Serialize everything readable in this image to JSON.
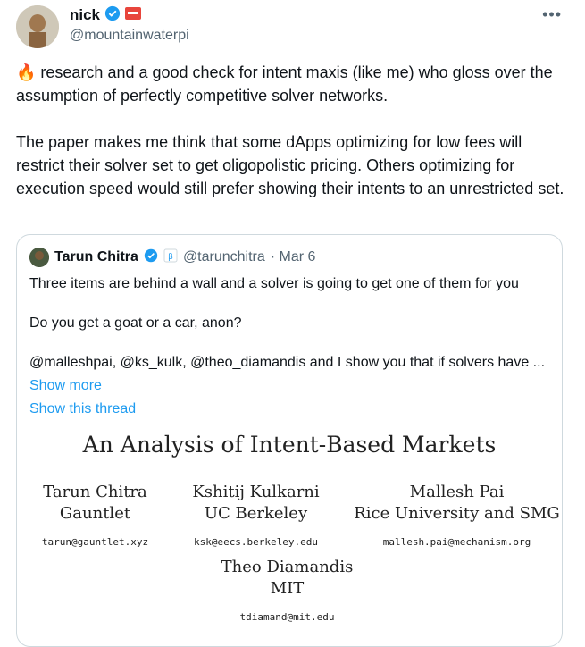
{
  "tweet": {
    "name": "nick",
    "handle": "@mountainwaterpi",
    "paragraphs": [
      "🔥 research and a good check for intent maxis (like me) who gloss over the assumption of perfectly competitive solver networks.",
      "The paper makes me think that some dApps optimizing for low fees will restrict their solver set to get oligopolistic pricing. Others optimizing for execution speed would still prefer showing their intents to an unrestricted set."
    ]
  },
  "quote": {
    "name": "Tarun Chitra",
    "handle": "@tarunchitra",
    "date": "· Mar 6",
    "lines": [
      "Three items are behind a wall and a solver is going to get one of them for you",
      "Do you get a goat or a car, anon?",
      "@malleshpai, @ks_kulk, @theo_diamandis and I show you that if solvers have ..."
    ],
    "show_more": "Show more",
    "show_thread": "Show this thread"
  },
  "paper": {
    "title": "An Analysis of Intent-Based Markets",
    "authors": [
      {
        "name": "Tarun Chitra",
        "affiliation": "Gauntlet",
        "email": "tarun@gauntlet.xyz"
      },
      {
        "name": "Kshitij Kulkarni",
        "affiliation": "UC Berkeley",
        "email": "ksk@eecs.berkeley.edu"
      },
      {
        "name": "Mallesh Pai",
        "affiliation": "Rice University and SMG",
        "email": "mallesh.pai@mechanism.org"
      },
      {
        "name": "Theo Diamandis",
        "affiliation": "MIT",
        "email": "tdiamand@mit.edu"
      }
    ]
  },
  "icons": {
    "verified": "verified-badge-icon",
    "more": "more-options-icon",
    "badge": "affiliate-badge-icon"
  },
  "colors": {
    "link": "#1d9bf0",
    "verified": "#1d9bf0",
    "muted": "#536471"
  }
}
